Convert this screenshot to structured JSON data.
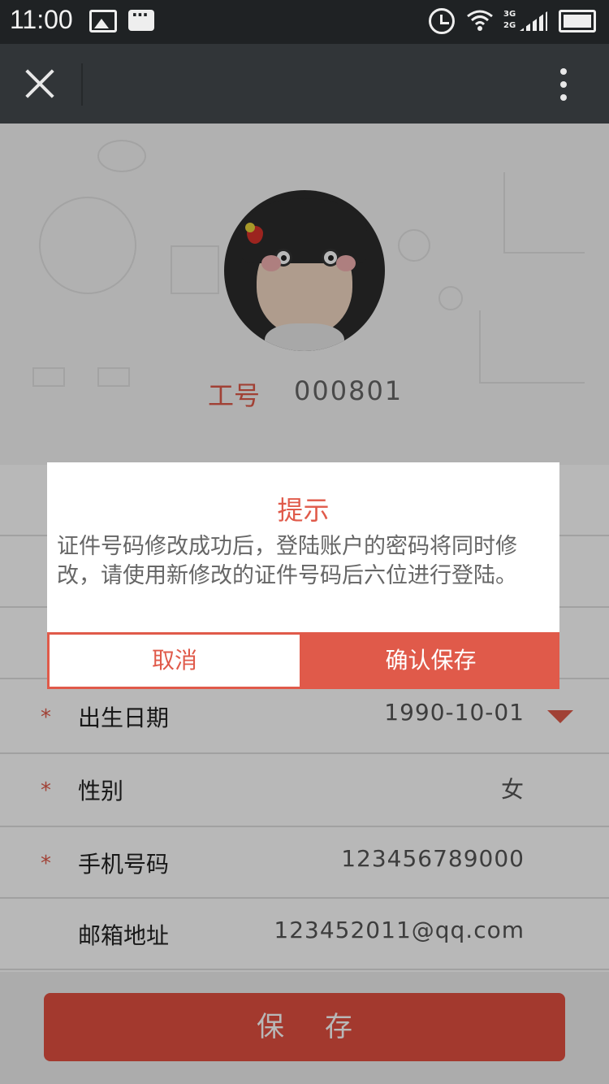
{
  "status_bar": {
    "time": "11:00",
    "network": "3G 2G"
  },
  "profile": {
    "staff_label": "工号",
    "staff_number": "000801"
  },
  "form": {
    "rows": [
      {
        "label": "出生日期",
        "value": "1990-10-01",
        "required": true,
        "has_dropdown": true
      },
      {
        "label": "性别",
        "value": "女",
        "required": true,
        "has_dropdown": false
      },
      {
        "label": "手机号码",
        "value": "123456789000",
        "required": true,
        "has_dropdown": false
      },
      {
        "label": "邮箱地址",
        "value": "123452011@qq.com",
        "required": false,
        "has_dropdown": false
      }
    ],
    "required_mark": "*"
  },
  "save_button": "保存",
  "dialog": {
    "title": "提示",
    "message": "证件号码修改成功后，登陆账户的密码将同时修改，请使用新修改的证件号码后六位进行登陆。",
    "cancel_label": "取消",
    "confirm_label": "确认保存"
  },
  "colors": {
    "accent": "#e05a4a",
    "appbar": "#313538",
    "statusbar": "#1f2224"
  }
}
